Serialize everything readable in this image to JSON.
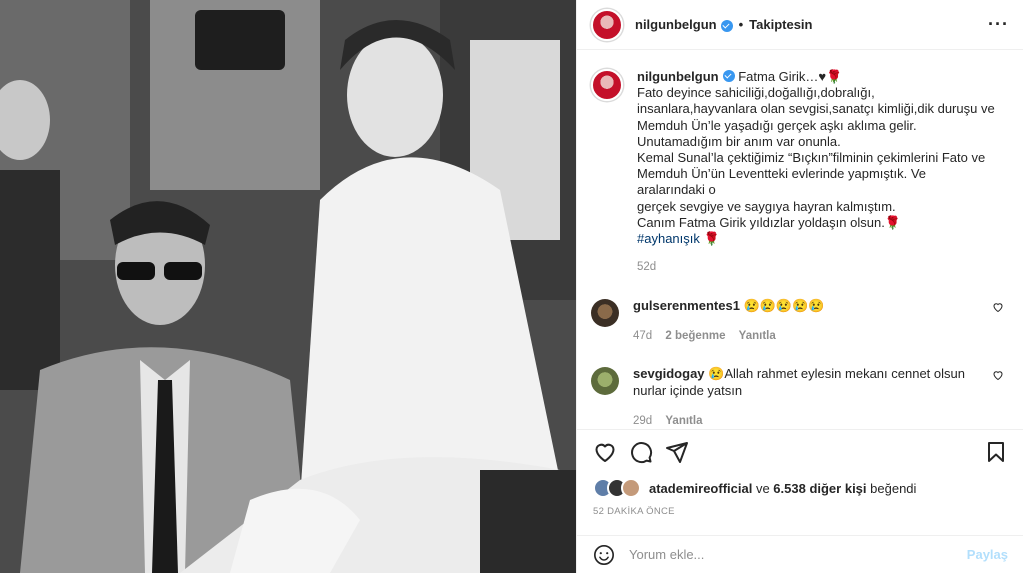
{
  "post": {
    "username": "nilgunbelgun",
    "follow_status": "Takiptesin",
    "caption_title": "Fatma Girik…♥🌹",
    "caption_body": "Fato deyince sahiciliği,doğallığı,dobralığı,\ninsanlara,hayvanlara olan sevgisi,sanatçı kimliği,dik duruşu ve\nMemduh Ün’le yaşadığı gerçek aşkı aklıma gelir.\nUnutamadığım bir anım var onunla.\nKemal Sunal’la çektiğimiz “Bıçkın”filminin çekimlerini Fato ve\nMemduh Ün’ün Leventteki evlerinde yapmıştık. Ve aralarındaki o\ngerçek sevgiye ve saygıya hayran kalmıştım.\nCanım Fatma Girik yıldızlar yoldaşın olsun.🌹",
    "hashtag": "#ayhanışık",
    "hashtag_suffix": " 🌹",
    "caption_age": "52d"
  },
  "comments": [
    {
      "username": "gulserenmentes1",
      "text": "😢😢😢😢😢",
      "age": "47d",
      "likes": "2 beğenme",
      "reply": "Yanıtla"
    },
    {
      "username": "sevgidogay",
      "text": "😢Allah rahmet eylesin mekanı cennet olsun nurlar içinde yatsın",
      "age": "29d",
      "reply": "Yanıtla"
    }
  ],
  "likes": {
    "first_user": "atademireofficial",
    "joiner": " ve ",
    "others": "6.538 diğer kişi",
    "suffix": " beğendi"
  },
  "timestamp": "52 DAKİKA ÖNCE",
  "comment_box": {
    "placeholder": "Yorum ekle...",
    "post_label": "Paylaş"
  },
  "icons": [
    "more-icon",
    "heart-icon",
    "comment-icon",
    "share-icon",
    "bookmark-icon",
    "emoji-icon"
  ]
}
